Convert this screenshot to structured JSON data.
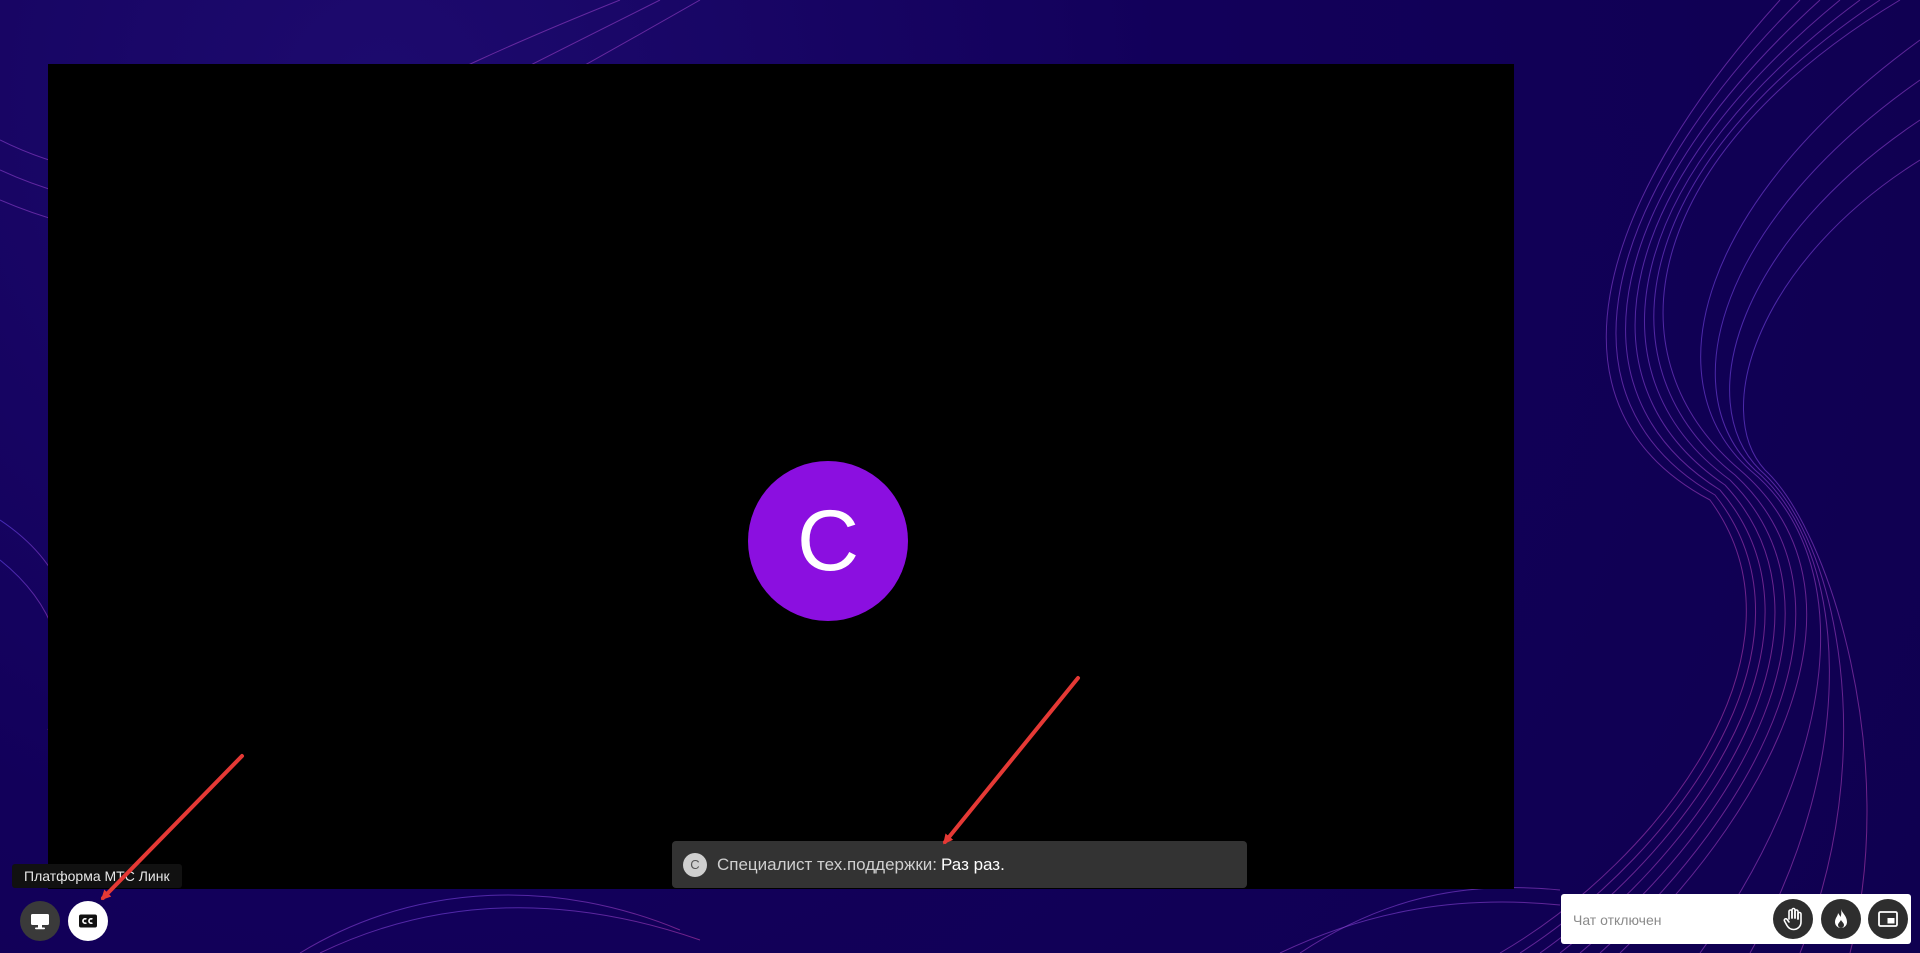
{
  "video": {
    "avatar_letter": "C"
  },
  "caption": {
    "avatar_letter": "C",
    "speaker": "Специалист тех.поддержки",
    "separator": ":",
    "text": "Раз раз."
  },
  "tooltip": {
    "text": "Платформа МТС Линк"
  },
  "controls": {
    "screen_icon": "monitor-icon",
    "cc_icon": "closed-captions-icon"
  },
  "chat": {
    "placeholder": "Чат отключен",
    "hand_icon": "raise-hand-icon",
    "fire_icon": "fire-icon",
    "pip_icon": "picture-in-picture-icon"
  },
  "colors": {
    "background": "#13005a",
    "avatar": "#8b0fe0",
    "caption_bg": "#333333",
    "annotation_arrow": "#e53935"
  }
}
